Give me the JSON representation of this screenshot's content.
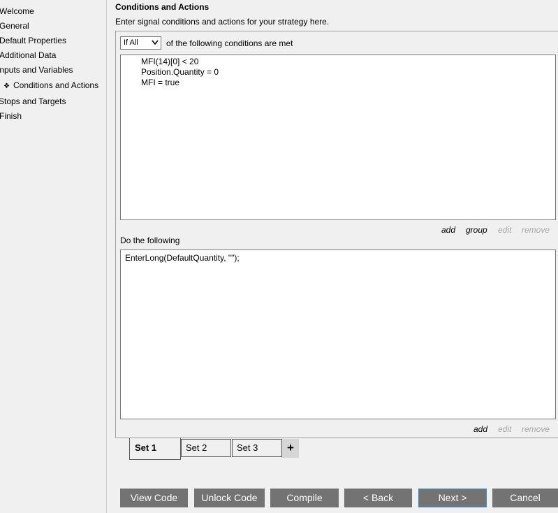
{
  "sidebar": {
    "items": [
      {
        "label": "Welcome"
      },
      {
        "label": "General"
      },
      {
        "label": "Default Properties"
      },
      {
        "label": "Additional Data"
      },
      {
        "label": "Inputs and Variables"
      },
      {
        "label": "Conditions and Actions",
        "icon": "diamond-bullet-icon",
        "selected": true
      },
      {
        "label": "Stops and Targets"
      },
      {
        "label": "Finish"
      }
    ]
  },
  "main": {
    "title": "Conditions and Actions",
    "description": "Enter signal conditions and actions for your strategy here.",
    "condition_select": {
      "value": "If All"
    },
    "condition_suffix": "of the following conditions are met",
    "conditions": [
      "MFI(14)[0] < 20",
      "Position.Quantity = 0",
      "MFI = true"
    ],
    "condition_links": {
      "add": "add",
      "group": "group",
      "edit": "edit",
      "remove": "remove"
    },
    "actions_label": "Do the following",
    "actions": [
      "EnterLong(DefaultQuantity, \"\");"
    ],
    "action_links": {
      "add": "add",
      "edit": "edit",
      "remove": "remove"
    }
  },
  "tabs": [
    {
      "label": "Set 1",
      "active": true
    },
    {
      "label": "Set 2"
    },
    {
      "label": "Set 3"
    }
  ],
  "tab_add_label": "+",
  "buttons": {
    "view_code": "View Code",
    "unlock_code": "Unlock Code",
    "compile": "Compile",
    "back": "< Back",
    "next": "Next >",
    "cancel": "Cancel"
  },
  "colors": {
    "button_bg": "#737373",
    "focus_border": "#2f8fd8",
    "disabled_link": "#a8a8a8"
  }
}
